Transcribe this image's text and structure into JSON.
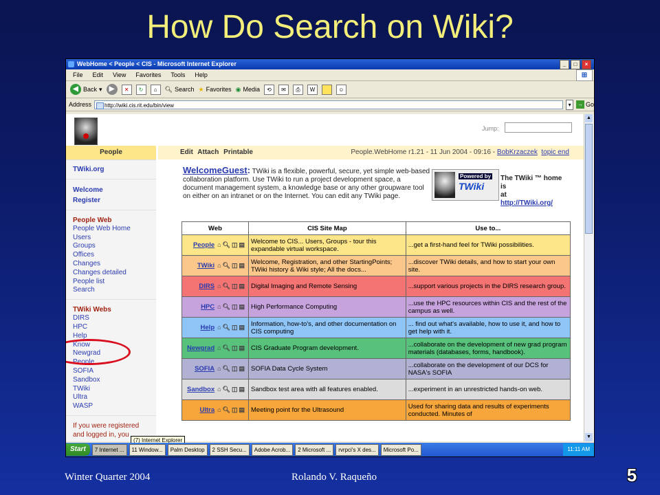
{
  "slide": {
    "title": "How Do Search on Wiki?",
    "footer_left": "Winter Quarter 2004",
    "footer_center": "Rolando V. Raqueño",
    "page_number": "5"
  },
  "browser": {
    "window_title": "WebHome < People < CIS - Microsoft Internet Explorer",
    "menu": [
      "File",
      "Edit",
      "View",
      "Favorites",
      "Tools",
      "Help"
    ],
    "toolbar": {
      "back": "Back",
      "search": "Search",
      "favorites": "Favorites",
      "media": "Media"
    },
    "address_label": "Address",
    "address_value": "http://wiki.cis.rit.edu/bin/view",
    "go_label": "Go"
  },
  "wiki": {
    "jump_label": "Jump:",
    "web_header": "People",
    "topic_actions": "Edit  Attach  Printable",
    "topic_meta_prefix": "People.WebHome  r1.21 - 11 Jun 2004 - 09:16 - ",
    "topic_author": "BobKrzaczek",
    "topic_end": "topic end",
    "sidebar": {
      "top_links": [
        "TWiki.org"
      ],
      "account_links": [
        "Welcome",
        "Register"
      ],
      "web_title": "People Web",
      "web_links": [
        "People Web Home",
        "Users",
        "Groups",
        "Offices",
        "Changes",
        "Changes detailed",
        "People list",
        "Search"
      ],
      "webs_title": "TWiki Webs",
      "webs": [
        "DIRS",
        "HPC",
        "Help",
        "Know",
        "Newgrad",
        "People",
        "SOFIA",
        "Sandbox",
        "TWiki",
        "Ultra",
        "WASP"
      ],
      "footer_text": "If you were registered and logged in, you"
    },
    "intro": {
      "welcome_link": "WelcomeGuest",
      "colon": ":",
      "text": " TWiki is a flexible, powerful, secure, yet simple web-based collaboration platform. Use TWiki to run a project development space, a document management system, a knowledge base or any other groupware tool on either on an intranet or on the Internet. You can edit any TWiki page."
    },
    "powered": {
      "caption": "Powered by",
      "logo": "TWiki"
    },
    "home_text": {
      "line1": "The TWiki ™ home",
      "line2": "is",
      "line3": "at",
      "url": "http://TWiki.org/"
    },
    "table": {
      "headers": [
        "Web",
        "CIS Site Map",
        "Use to..."
      ],
      "rows": [
        {
          "web": "People",
          "color": "#fde58a",
          "map": "Welcome to CIS... Users, Groups - tour this expandable virtual workspace.",
          "use": "...get a first-hand feel for TWiki possibilities."
        },
        {
          "web": "TWiki",
          "color": "#fcc78a",
          "map": "Welcome, Registration, and other StartingPoints; TWiki history & Wiki style; All the docs...",
          "use": "...discover TWiki details, and how to start your own site."
        },
        {
          "web": "DIRS",
          "color": "#f47474",
          "map": "Digital Imaging and Remote Sensing",
          "use": "...support various projects in the DIRS research group."
        },
        {
          "web": "HPC",
          "color": "#c7a3de",
          "map": "High Performance Computing",
          "use": "...use the HPC resources within CIS and the rest of the campus as well."
        },
        {
          "web": "Help",
          "color": "#8fc4f6",
          "map": "Information, how-to's, and other documentation on CIS computing",
          "use": "... find out what's available, how to use it, and how to get help with it."
        },
        {
          "web": "Newgrad",
          "color": "#58c27d",
          "map": "CIS Graduate Program development.",
          "use": "...collaborate on the development of new grad program materials (databases, forms, handbook)."
        },
        {
          "web": "SOFIA",
          "color": "#b1b1d4",
          "map": "SOFIA Data Cycle System",
          "use": "...collaborate on the development of our DCS for NASA's SOFIA"
        },
        {
          "web": "Sandbox",
          "color": "#dcdcdc",
          "map": "Sandbox test area with all features enabled.",
          "use": "...experiment in an unrestricted hands-on web."
        },
        {
          "web": "Ultra",
          "color": "#f6a63a",
          "map": "Meeting point for the Ultrasound",
          "use": "Used for sharing data and results of experiments conducted. Minutes of"
        }
      ]
    },
    "tooltip": "(7) Internet Explorer"
  },
  "taskbar": {
    "start": "Start",
    "tasks": [
      "7 Internet ...",
      "11 Window...",
      "Palm Desktop",
      "2 SSH Secu...",
      "Adobe Acrob...",
      "2 Microsoft ...",
      "rvrpci's X des...",
      "Microsoft Po..."
    ],
    "clock": "11:11 AM"
  }
}
